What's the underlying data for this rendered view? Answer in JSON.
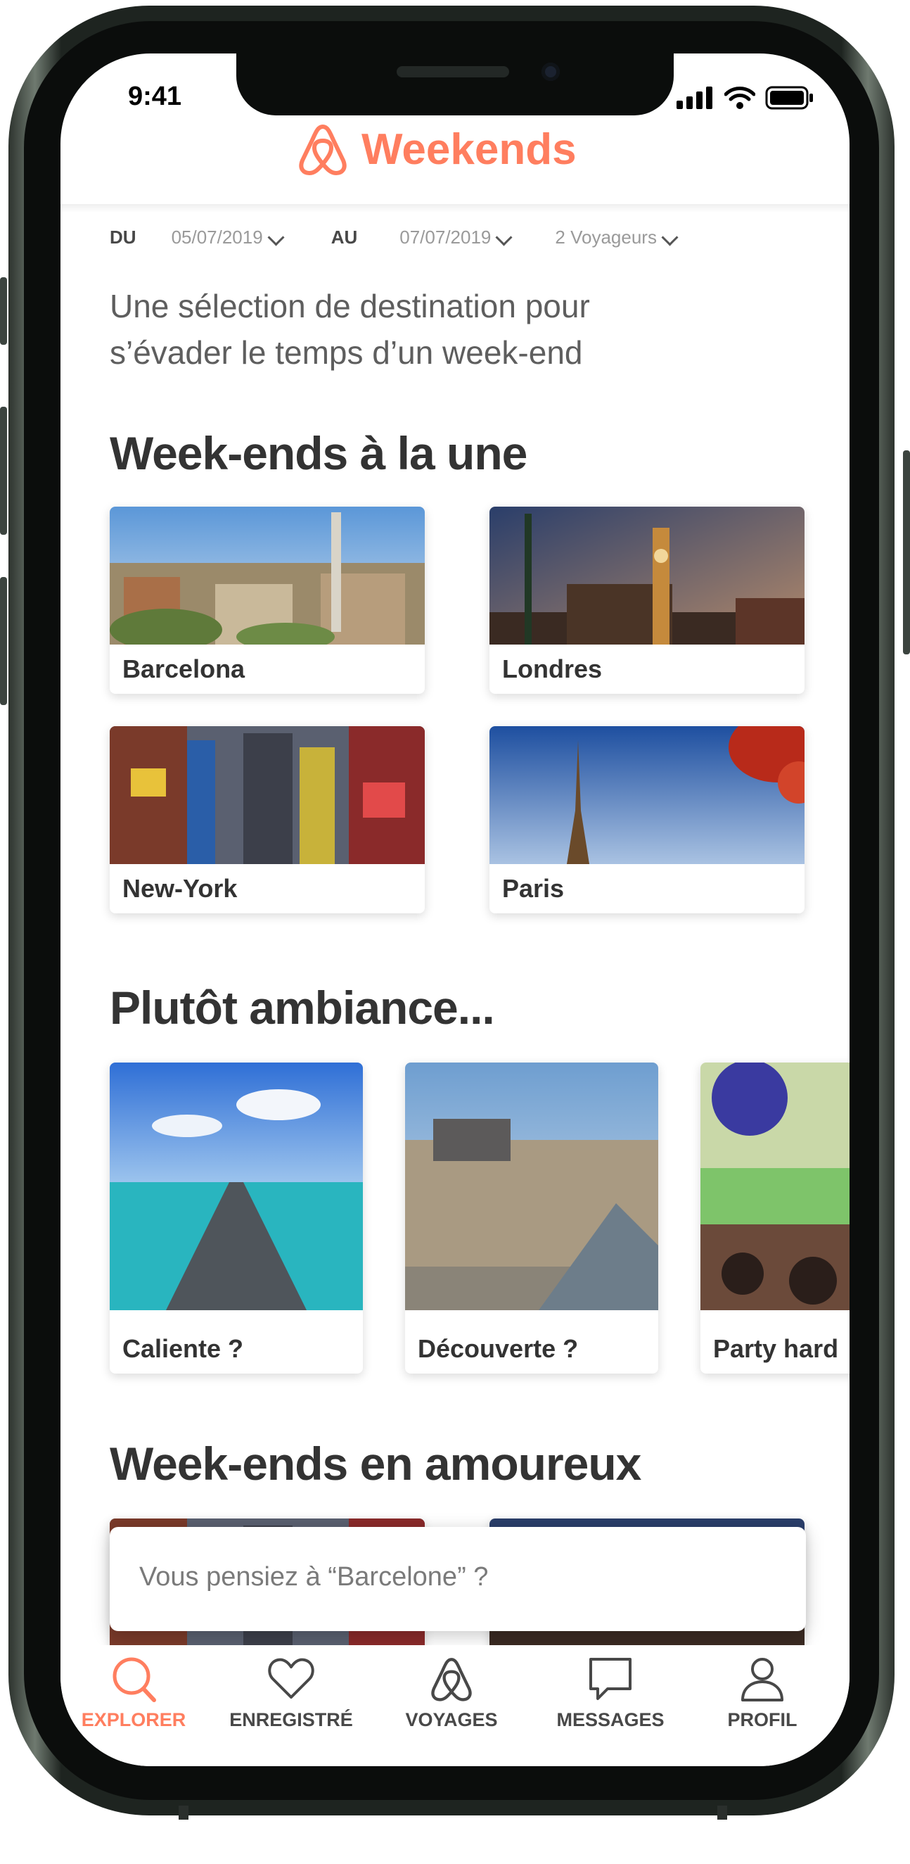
{
  "status_bar": {
    "time": "9:41"
  },
  "header": {
    "title": "Weekends",
    "brand_color": "#ff7e5f"
  },
  "search": {
    "from_label": "DU",
    "from_date": "05/07/2019",
    "to_label": "AU",
    "to_date": "07/07/2019",
    "travellers": "2 Voyageurs"
  },
  "intro": "Une sélection de destination pour s’évader le temps d’un week-end",
  "sections": {
    "featured": {
      "title": "Week-ends à la une",
      "cards": [
        "Barcelona",
        "Londres",
        "New-York",
        "Paris"
      ]
    },
    "ambiance": {
      "title": "Plutôt ambiance...",
      "cards": [
        "Caliente ?",
        "Découverte ?",
        "Party hard"
      ]
    },
    "romantic": {
      "title": "Week-ends en amoureux"
    }
  },
  "suggestion": "Vous pensiez à “Barcelone” ?",
  "tabs": [
    {
      "label": "EXPLORER",
      "icon": "search-icon",
      "active": true
    },
    {
      "label": "ENREGISTRÉ",
      "icon": "heart-icon"
    },
    {
      "label": "VOYAGES",
      "icon": "airbnb-logo-icon"
    },
    {
      "label": "MESSAGES",
      "icon": "chat-bubble-icon"
    },
    {
      "label": "PROFIL",
      "icon": "user-icon"
    }
  ]
}
